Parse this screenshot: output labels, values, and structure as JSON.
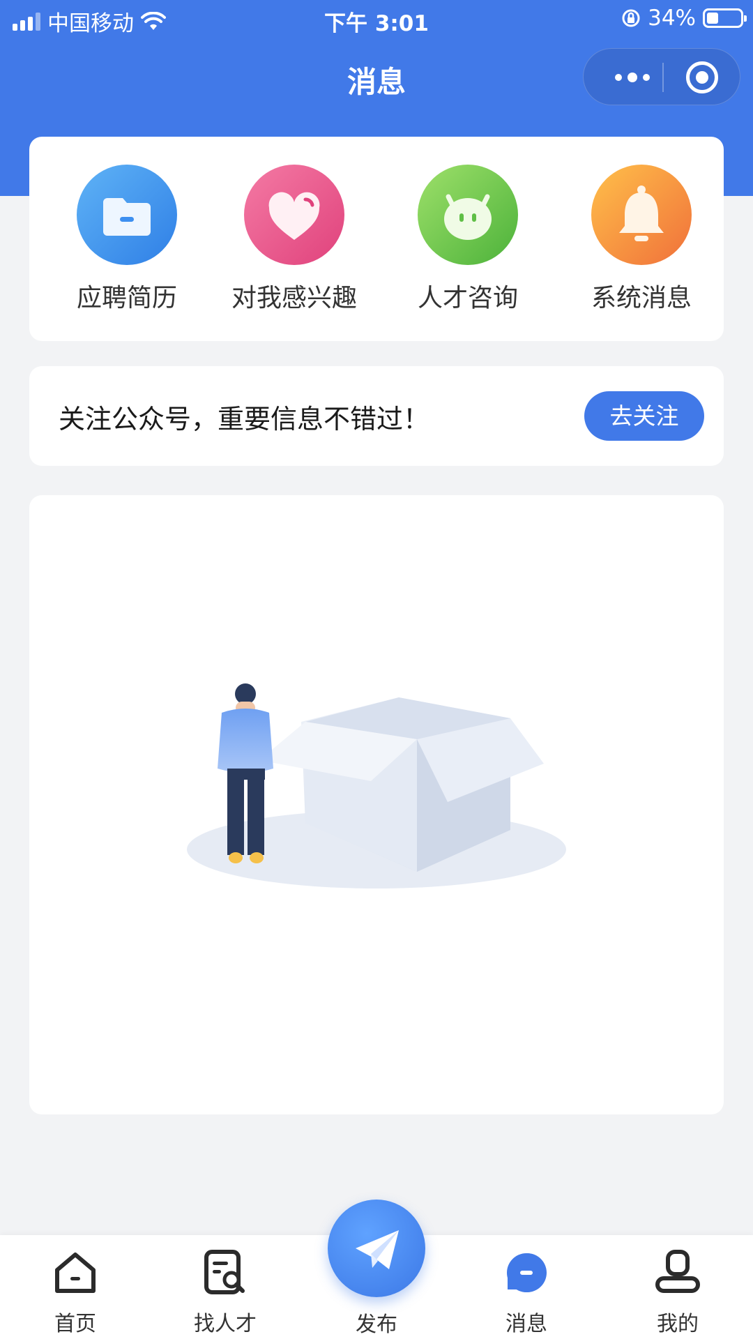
{
  "status_bar": {
    "carrier": "中国移动",
    "time": "下午 3:01",
    "battery_percent": "34%",
    "battery_level": 0.34,
    "icons": [
      "signal-icon",
      "wifi-icon",
      "rotation-lock-icon",
      "battery-icon"
    ]
  },
  "nav": {
    "title": "消息",
    "menu_icon": "more-dots-icon",
    "close_icon": "target-icon"
  },
  "quick_actions": [
    {
      "label": "应聘简历",
      "icon": "folder-icon",
      "colors": [
        "#5fb3f6",
        "#2f7fe6"
      ]
    },
    {
      "label": "对我感兴趣",
      "icon": "heart-icon",
      "colors": [
        "#f47aa4",
        "#e0427c"
      ]
    },
    {
      "label": "人才咨询",
      "icon": "smiley-devil-icon",
      "colors": [
        "#9ee06a",
        "#4cb23a"
      ]
    },
    {
      "label": "系统消息",
      "icon": "bell-icon",
      "colors": [
        "#ffc04a",
        "#f0703a"
      ]
    }
  ],
  "follow_banner": {
    "text": "关注公众号，重要信息不错过！",
    "button_label": "去关注"
  },
  "empty_state": {
    "illustration": "person-with-empty-box-illustration"
  },
  "tabbar": {
    "items": [
      {
        "label": "首页",
        "icon": "home-icon",
        "active": false
      },
      {
        "label": "找人才",
        "icon": "search-document-icon",
        "active": false
      },
      {
        "label": "发布",
        "icon": "paper-plane-icon",
        "active": false
      },
      {
        "label": "消息",
        "icon": "message-bubble-icon",
        "active": true
      },
      {
        "label": "我的",
        "icon": "user-icon",
        "active": false
      }
    ]
  },
  "colors": {
    "primary": "#4179e8",
    "background": "#f2f3f5",
    "card": "#ffffff"
  }
}
